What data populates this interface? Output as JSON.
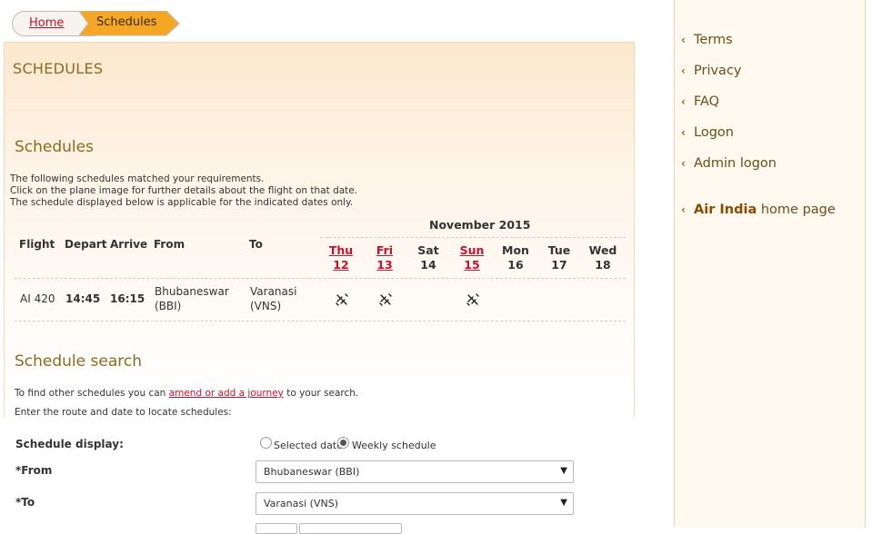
{
  "breadcrumb": {
    "home": "Home",
    "current": "Schedules"
  },
  "page_title": "SCHEDULES",
  "schedules": {
    "title": "Schedules",
    "notes": [
      "The following schedules matched your requirements.",
      "Click on the plane image for further details about the flight on that date.",
      "The schedule displayed below is applicable for the indicated dates only."
    ],
    "headers": {
      "flight": "Flight",
      "depart": "Depart",
      "arrive": "Arrive",
      "from": "From",
      "to": "To"
    },
    "month": "November 2015",
    "days": [
      {
        "name": "Thu",
        "num": "12",
        "link": true
      },
      {
        "name": "Fri",
        "num": "13",
        "link": true
      },
      {
        "name": "Sat",
        "num": "14",
        "link": false
      },
      {
        "name": "Sun",
        "num": "15",
        "link": true
      },
      {
        "name": "Mon",
        "num": "16",
        "link": false
      },
      {
        "name": "Tue",
        "num": "17",
        "link": false
      },
      {
        "name": "Wed",
        "num": "18",
        "link": false
      }
    ],
    "rows": [
      {
        "flight": "AI 420",
        "depart": "14:45",
        "arrive": "16:15",
        "from_line1": "Bhubaneswar",
        "from_line2": "(BBI)",
        "to_line1": "Varanasi",
        "to_line2": "(VNS)",
        "operates": [
          true,
          true,
          false,
          true,
          false,
          false,
          false
        ]
      }
    ]
  },
  "search": {
    "title": "Schedule search",
    "text_before": "To find other schedules you can ",
    "link": "amend or add a journey",
    "text_after": " to your search.",
    "hint": "Enter the route and date to locate schedules:",
    "display_label": "Schedule display:",
    "option_selected_date": "Selected date",
    "option_weekly": "Weekly schedule",
    "weekly_selected": true,
    "from_label": "*From",
    "from_value": "Bhubaneswar (BBI)",
    "to_label": "*To",
    "to_value": "Varanasi (VNS)"
  },
  "sidebar": {
    "items": [
      "Terms",
      "Privacy",
      "FAQ",
      "Logon",
      "Admin logon"
    ],
    "home_brand": "Air India",
    "home_suffix": " home page"
  },
  "colors": {
    "accent": "#8a6a1e",
    "link": "#c8102e",
    "breadcrumb_active": "#f5a623"
  }
}
